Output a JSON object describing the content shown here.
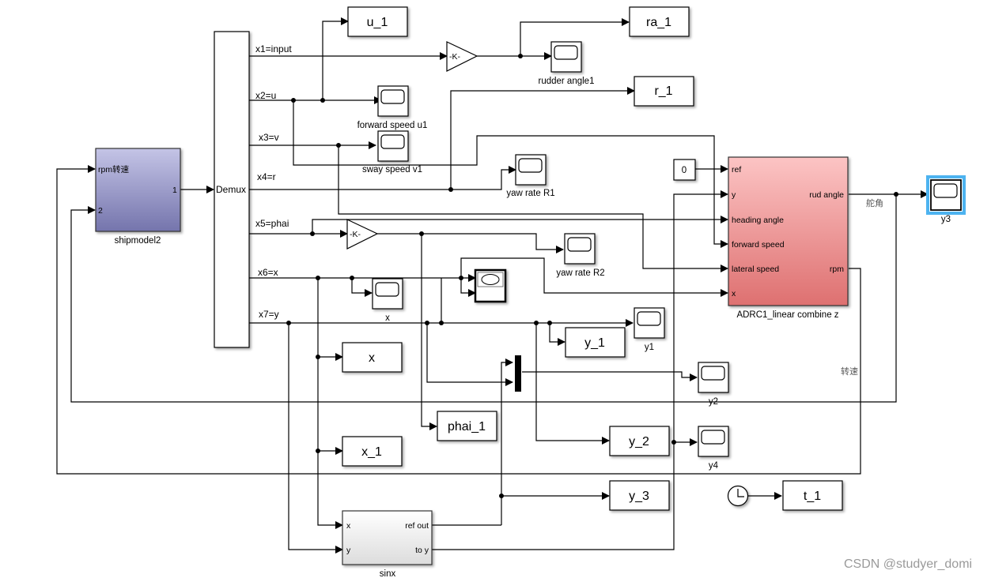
{
  "diagram": {
    "type": "simulink-block-diagram",
    "blocks": {
      "shipmodel": {
        "name": "shipmodel2",
        "in_ports": [
          "rpm转速",
          "2"
        ],
        "out_ports": [
          "1"
        ],
        "color": "#8f8fc4"
      },
      "demux": {
        "name": "Demux"
      },
      "gain_rudder": {
        "label": "-K-"
      },
      "gain_phai": {
        "label": "-K-"
      },
      "adrc": {
        "name": "ADRC1_linear combine z",
        "in_ports": [
          "ref",
          "y",
          "heading angle",
          "forward speed",
          "lateral speed",
          "x"
        ],
        "out_ports": [
          "rud angle",
          "rpm"
        ],
        "color": "#f4a6a6"
      },
      "sinx": {
        "name": "sinx",
        "in_ports": [
          "x",
          "y"
        ],
        "out_ports": [
          "ref out",
          "to y"
        ]
      },
      "constant": {
        "value": "0"
      },
      "clock": {
        "name": "clock"
      },
      "workspace": {
        "u_1": "u_1",
        "ra_1": "ra_1",
        "r_1": "r_1",
        "x": "x",
        "x_1": "x_1",
        "phai_1": "phai_1",
        "y_1": "y_1",
        "y_2": "y_2",
        "y_3": "y_3",
        "t_1": "t_1"
      },
      "scopes": {
        "rudder_angle1": "rudder angle1",
        "forward_speed_u1": "forward speed u1",
        "sway_speed_v1": "sway speed v1",
        "yaw_rate_R1": "yaw rate R1",
        "yaw_rate_R2": "yaw rate R2",
        "x": "x",
        "y1": "y1",
        "y2": "y2",
        "y3": "y3",
        "y4": "y4"
      }
    },
    "signals": {
      "x1": "x1=input",
      "x2": "x2=u",
      "x3": "x3=v",
      "x4": "x4=r",
      "x5": "x5=phai",
      "x6": "x6=x",
      "x7": "x7=y",
      "rud_angle": "舵角",
      "rpm": "转速"
    },
    "selected_block": "y3",
    "selection_color": "#4db3f0"
  },
  "watermark": "CSDN @studyer_domi"
}
